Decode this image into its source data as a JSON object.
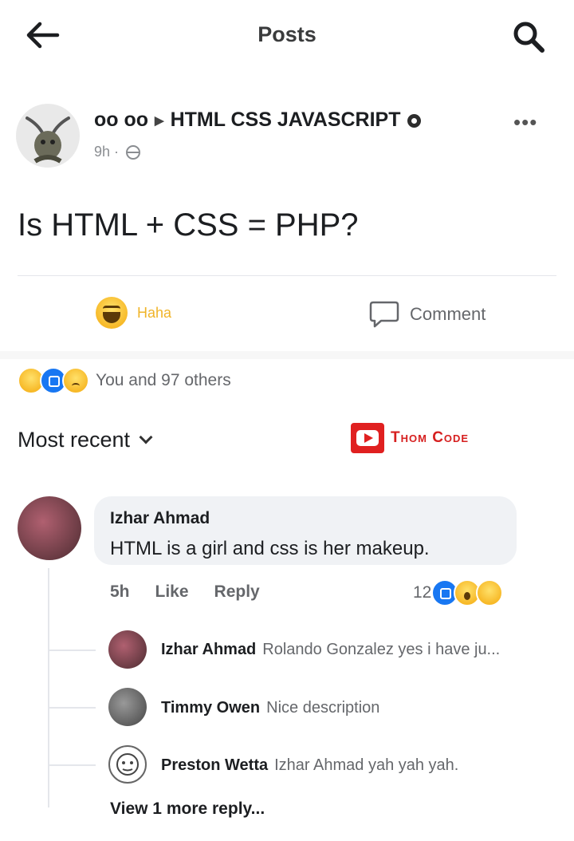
{
  "header": {
    "title": "Posts",
    "back_icon": "arrow-left-icon",
    "search_icon": "search-icon"
  },
  "post": {
    "author": "oo oo",
    "group": "HTML CSS JAVASCRIPT",
    "time": "9h ·",
    "text": "Is HTML + CSS = PHP?",
    "more_icon": "•••",
    "actions": {
      "haha_label": "Haha",
      "comment_label": "Comment"
    },
    "reactions_summary": "You and 97 others"
  },
  "sort_label": "Most recent",
  "watermark": "Thom Code",
  "comment": {
    "author": "Izhar Ahmad",
    "text": "HTML is a girl and css is her makeup.",
    "time": "5h",
    "like_label": "Like",
    "reply_label": "Reply",
    "reaction_count": "12"
  },
  "replies": [
    {
      "author": "Izhar Ahmad",
      "text": "Rolando Gonzalez yes i have ju..."
    },
    {
      "author": "Timmy Owen",
      "text": "Nice description"
    },
    {
      "author": "Preston Wetta",
      "text": "Izhar Ahmad  yah yah yah."
    }
  ],
  "view_more_replies": "View 1 more reply...",
  "colors": {
    "like_blue": "#1877f2",
    "haha_yellow": "#f7b928",
    "watermark_red": "#e02020"
  }
}
